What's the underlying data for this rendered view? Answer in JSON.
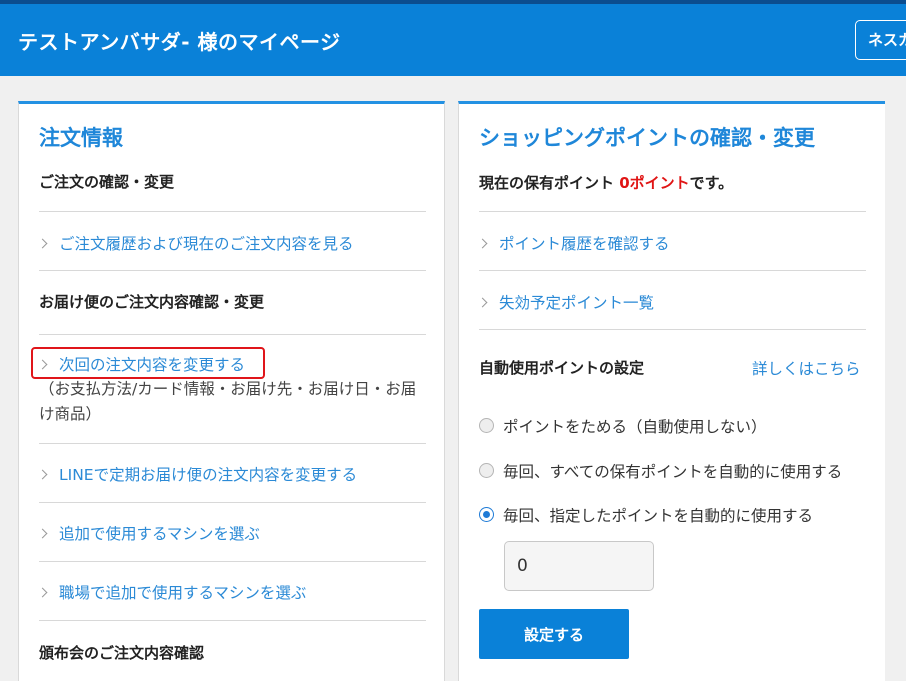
{
  "header": {
    "title": "テストアンバサダ- 様のマイページ",
    "next_button": "ネスカ"
  },
  "order_panel": {
    "title": "注文情報",
    "section1_heading": "ご注文の確認・変更",
    "link_history": "ご注文履歴および現在のご注文内容を見る",
    "section2_heading": "お届け便のご注文内容確認・変更",
    "link_change_next": "次回の注文内容を変更する",
    "change_next_note": "（お支払方法/カード情報・お届け先・お届け日・お届け商品）",
    "link_line": "LINEで定期お届け便の注文内容を変更する",
    "link_add_machine": "追加で使用するマシンを選ぶ",
    "link_workplace_machine": "職場で追加で使用するマシンを選ぶ",
    "section3_heading": "頒布会のご注文内容確認"
  },
  "points_panel": {
    "title": "ショッピングポイントの確認・変更",
    "current_prefix": "現在の保有ポイント ",
    "current_value": "0ポイント",
    "current_suffix": "です。",
    "link_history": "ポイント履歴を確認する",
    "link_expiry": "失効予定ポイント一覧",
    "auto_heading": "自動使用ポイントの設定",
    "details_link": "詳しくはこちら",
    "options": [
      "ポイントをためる（自動使用しない）",
      "毎回、すべての保有ポイントを自動的に使用する",
      "毎回、指定したポイントを自動的に使用する"
    ],
    "selected_option_index": 2,
    "amount_value": "0",
    "submit_label": "設定する"
  },
  "colors": {
    "header_blue": "#0a81d8",
    "link_blue": "#2b8ad6",
    "highlight_red": "#e0151a",
    "points_red": "#e01515"
  }
}
